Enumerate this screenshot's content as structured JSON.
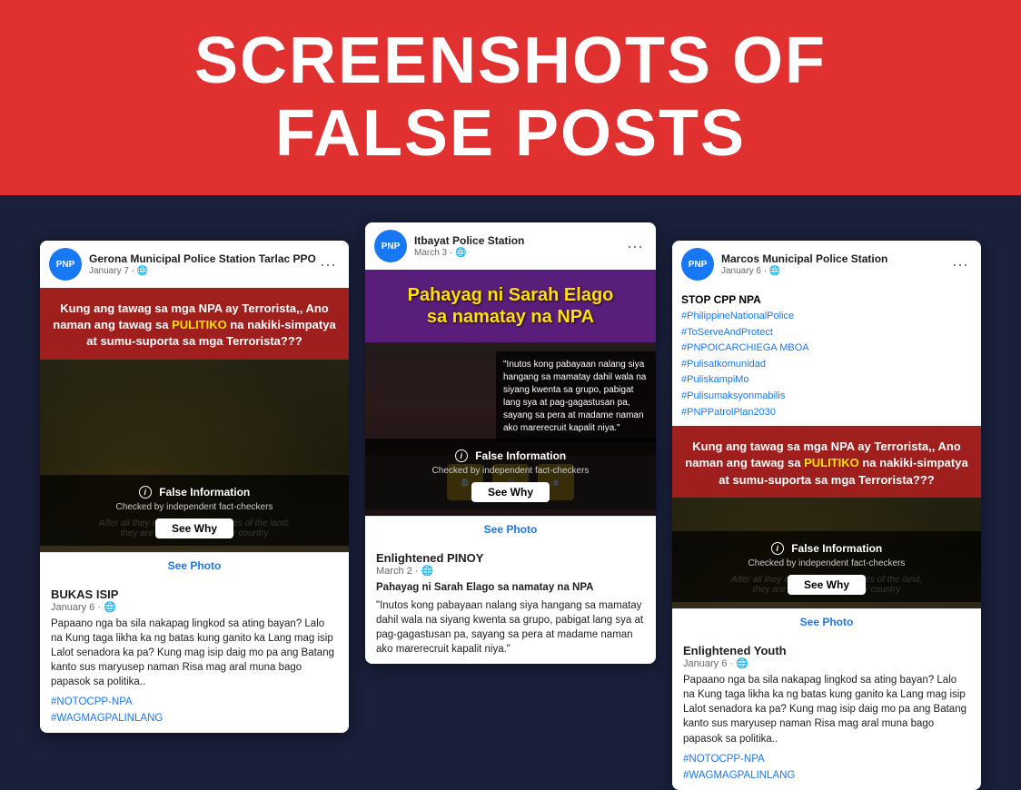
{
  "header": {
    "title_line1": "SCREENSHOTS OF",
    "title_line2": "FALSE POSTS",
    "bg_color": "#e03030"
  },
  "posts": {
    "left": {
      "page_name": "Gerona Municipal Police Station Tarlac PPO",
      "date": "January 7 · 🌐",
      "menu": "···",
      "overlay_text_normal": "Kung ang tawag sa mga NPA ay Terrorista,, Ano naman ang tawag sa ",
      "overlay_text_highlight": "PULITIKO",
      "overlay_text_normal2": " na nakiki-simpatya at sumu-suporta sa mga Terrorista???",
      "false_info_label": "False Information",
      "false_info_sub": "Checked by independent fact-checkers",
      "see_why": "See Why",
      "see_photo": "See Photo",
      "soldiers_text_line1": "After all they are considered heroes of the land,",
      "soldiers_text_line2": "they are risking their lives for country",
      "body_page": "BUKAS ISIP",
      "body_date": "January 6 · 🌐",
      "body_text": "Papaano nga ba sila nakapag lingkod sa ating bayan? Lalo na Kung taga likha ka ng batas kung ganito ka Lang mag isip Lalot senadora ka pa? Kung mag isip daig mo pa ang Batang kanto sus maryusep naman Risa mag aral muna bago papasok sa politika..",
      "hashtag1": "#NOTOCPP-NPA",
      "hashtag2": "#WAGMAGPALINLANG"
    },
    "center": {
      "page_name": "Itbayat Police Station",
      "date": "March 3 · 🌐",
      "menu": "···",
      "title_line1": "Pahayag ni Sarah Elago",
      "title_line2": "sa namatay na NPA",
      "quote_text": "\"Inutos kong pabayaan nalang siya hangang sa mamatay dahil wala na siyang kwenta sa grupo, pabigat lang sya at pag-gagastusan pa, sayang sa pera at madame naman ako marerecruit kapalit niya.\"",
      "false_info_label": "False Information",
      "false_info_sub": "Checked by independent fact-checkers",
      "see_why": "See Why",
      "see_photo": "See Photo",
      "body_page": "Enlightened PINOY",
      "body_date": "March 2 · 🌐",
      "body_title": "Pahayag ni Sarah Elago sa namatay na NPA",
      "body_text": "\"Inutos kong pabayaan nalang siya hangang sa mamatay dahil wala na siyang kwenta sa grupo, pabigat lang sya at pag-gagastusan pa, sayang sa pera at madame naman ako marerecruit kapalit niya.\""
    },
    "right": {
      "page_name": "Marcos Municipal Police Station",
      "date": "January 6 · 🌐",
      "menu": "···",
      "stop_cpp": "STOP CPP NPA",
      "hashtag1": "#PhilippineNationalPolice",
      "hashtag2": "#ToServeAndProtect",
      "hashtag3": "#PNPOICARCHIEGA MBOA",
      "hashtag4": "#Pulisatkomunidad",
      "hashtag5": "#PuliskampiMo",
      "hashtag6": "#Pulisumaksyonmabilis",
      "hashtag7": "#PNPPatrolPlan2030",
      "overlay_text_normal": "Kung ang tawag sa mga NPA ay Terrorista,, Ano naman ang tawag sa ",
      "overlay_text_highlight": "PULITIKO",
      "overlay_text_normal2": " na nakiki-simpatya at sumu-suporta sa mga Terrorista???",
      "false_info_label": "False Information",
      "false_info_sub": "Checked by independent fact-checkers",
      "see_why": "See Why",
      "see_photo": "See Photo",
      "soldiers_text_line1": "After all they are considered heroes of the land,",
      "soldiers_text_line2": "they are risking their lives for country",
      "body_page": "Enlightened Youth",
      "body_date": "January 6 · 🌐",
      "body_text": "Papaano nga ba sila nakapag lingkod sa ating bayan? Lalo na Kung taga likha ka ng batas kung ganito ka Lang mag isip Lalot senadora ka pa? Kung mag isip daig mo pa ang Batang kanto sus maryusep naman Risa mag aral muna bago papasok sa politika..",
      "hashtag_b1": "#NOTOCPP-NPA",
      "hashtag_b2": "#WAGMAGPALINLANG"
    }
  }
}
